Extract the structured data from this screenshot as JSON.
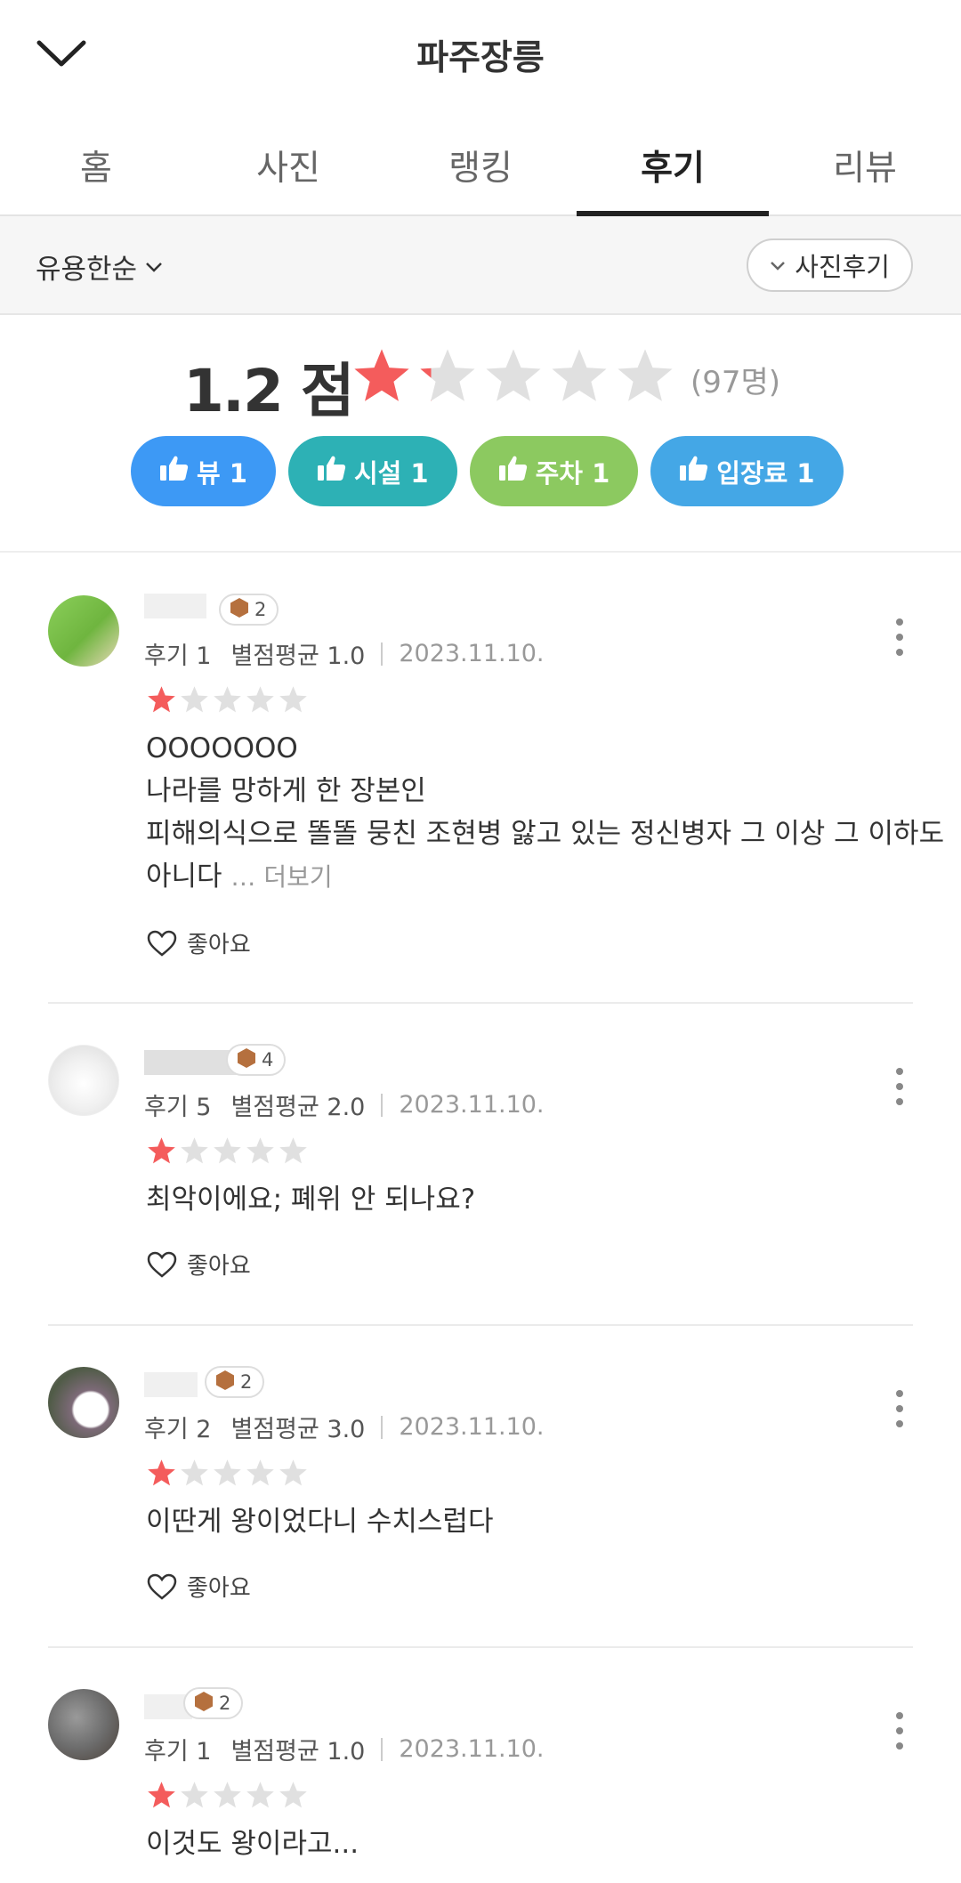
{
  "header": {
    "title": "파주장릉"
  },
  "tabs": [
    "홈",
    "사진",
    "랭킹",
    "후기",
    "리뷰"
  ],
  "active_tab": "후기",
  "filter": {
    "sort_label": "유용한순",
    "photo_filter_label": "사진후기"
  },
  "summary": {
    "score_text": "1.2 점",
    "rating": 1.2,
    "rating_max": 5,
    "count_text": "(97명)",
    "chips": [
      {
        "label": "뷰 1",
        "color": "#3d99f5"
      },
      {
        "label": "시설 1",
        "color": "#2db1b5"
      },
      {
        "label": "주차 1",
        "color": "#8cc960"
      },
      {
        "label": "입장료 1",
        "color": "#44a7e6"
      }
    ]
  },
  "colors": {
    "star_on": "#f45c5c",
    "star_off": "#e0e0e0"
  },
  "reviews": [
    {
      "level": "2",
      "review_count": "후기 1",
      "avg": "별점평균 1.0",
      "date": "2023.11.10.",
      "stars": 1,
      "lines": [
        "OOOOOOO",
        "나라를 망하게 한 장본인",
        "피해의식으로 똘똘 뭉친 조현병 앓고 있는 정신병자 그 이상 그 이하도"
      ],
      "last_line": "아니다",
      "more": "… 더보기",
      "like": "좋아요"
    },
    {
      "level": "4",
      "review_count": "후기 5",
      "avg": "별점평균 2.0",
      "date": "2023.11.10.",
      "stars": 1,
      "lines": [
        "최악이에요; 폐위 안 되나요?"
      ],
      "like": "좋아요"
    },
    {
      "level": "2",
      "review_count": "후기 2",
      "avg": "별점평균 3.0",
      "date": "2023.11.10.",
      "stars": 1,
      "lines": [
        "이딴게 왕이었다니 수치스럽다"
      ],
      "like": "좋아요"
    },
    {
      "level": "2",
      "review_count": "후기 1",
      "avg": "별점평균 1.0",
      "date": "2023.11.10.",
      "stars": 1,
      "lines": [
        "이것도 왕이라고..."
      ]
    }
  ]
}
